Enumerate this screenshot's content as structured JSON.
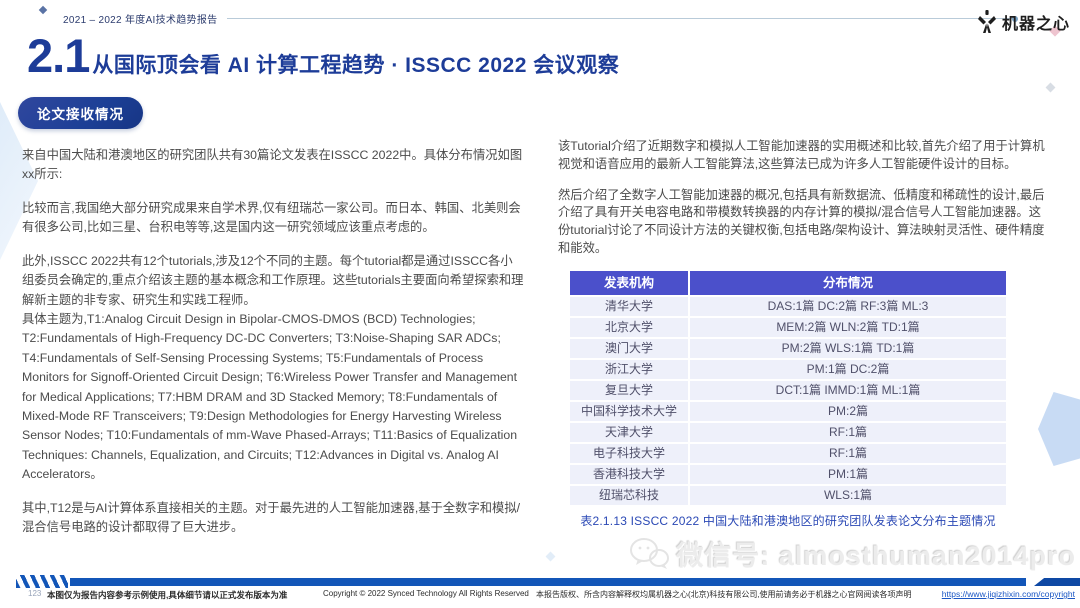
{
  "header": {
    "report_label": "2021 – 2022 年度AI技术趋势报告",
    "logo_text": "机器之心",
    "section_number": "2.1",
    "title": "从国际顶会看 AI 计算工程趋势 · ISSCC 2022 会议观察",
    "badge": "论文接收情况"
  },
  "left_column": {
    "paragraphs": [
      "来自中国大陆和港澳地区的研究团队共有30篇论文发表在ISSCC 2022中。具体分布情况如图xx所示:",
      "比较而言,我国绝大部分研究成果来自学术界,仅有纽瑞芯一家公司。而日本、韩国、北美则会有很多公司,比如三星、台积电等等,这是国内这一研究领域应该重点考虑的。",
      "此外,ISSCC 2022共有12个tutorials,涉及12个不同的主题。每个tutorial都是通过ISSCC各小组委员会确定的,重点介绍该主题的基本概念和工作原理。这些tutorials主要面向希望探索和理解新主题的非专家、研究生和实践工程师。",
      "具体主题为,T1:Analog Circuit Design in Bipolar-CMOS-DMOS (BCD) Technologies; T2:Fundamentals of High-Frequency DC-DC Converters; T3:Noise-Shaping SAR ADCs; T4:Fundamentals of Self-Sensing Processing Systems; T5:Fundamentals of Process Monitors for Signoff-Oriented Circuit Design; T6:Wireless Power Transfer and Management for Medical Applications; T7:HBM DRAM and 3D Stacked Memory; T8:Fundamentals of Mixed-Mode RF Transceivers; T9:Design Methodologies for Energy Harvesting Wireless Sensor Nodes; T10:Fundamentals of mm-Wave Phased-Arrays; T11:Basics of Equalization Techniques: Channels, Equalization, and Circuits; T12:Advances in Digital vs. Analog AI Accelerators。",
      "其中,T12是与AI计算体系直接相关的主题。对于最先进的人工智能加速器,基于全数字和模拟/混合信号电路的设计都取得了巨大进步。"
    ]
  },
  "right_column": {
    "paragraphs": [
      "该Tutorial介绍了近期数字和模拟人工智能加速器的实用概述和比较,首先介绍了用于计算机视觉和语音应用的最新人工智能算法,这些算法已成为许多人工智能硬件设计的目标。",
      "然后介绍了全数字人工智能加速器的概况,包括具有新数据流、低精度和稀疏性的设计,最后介绍了具有开关电容电路和带模数转换器的内存计算的模拟/混合信号人工智能加速器。这份tutorial讨论了不同设计方法的关键权衡,包括电路/架构设计、算法映射灵活性、硬件精度和能效。"
    ],
    "table": {
      "headers": [
        "发表机构",
        "分布情况"
      ],
      "rows": [
        [
          "清华大学",
          "DAS:1篇  DC:2篇  RF:3篇 ML:3"
        ],
        [
          "北京大学",
          "MEM:2篇 WLN:2篇 TD:1篇"
        ],
        [
          "澳门大学",
          "PM:2篇 WLS:1篇 TD:1篇"
        ],
        [
          "浙江大学",
          "PM:1篇 DC:2篇"
        ],
        [
          "复旦大学",
          "DCT:1篇 IMMD:1篇 ML:1篇"
        ],
        [
          "中国科学技术大学",
          "PM:2篇"
        ],
        [
          "天津大学",
          "RF:1篇"
        ],
        [
          "电子科技大学",
          "RF:1篇"
        ],
        [
          "香港科技大学",
          "PM:1篇"
        ],
        [
          "纽瑞芯科技",
          "WLS:1篇"
        ]
      ],
      "caption": "表2.1.13 ISSCC 2022 中国大陆和港澳地区的研究团队发表论文分布主题情况"
    }
  },
  "watermark": {
    "wechat_label": "微信号: almosthuman2014pro"
  },
  "footer": {
    "page_number": "123",
    "disclaimer": "本图仅为报告内容参考示例使用,具体细节请以正式发布版本为准",
    "copyright": "Copyright © 2022 Synced Technology  All Rights Reserved",
    "rights": "本报告版权、所含内容解释权均属机器之心(北京)科技有限公司,使用前请务必于机器之心官网阅读各项声明",
    "link": "https://www.jiqizhixin.com/copyright"
  },
  "colors": {
    "title_blue": "#1d3c98",
    "badge_blue": "#1c3f96",
    "table_header_bg": "#4b50cb",
    "table_row_bg": "#eef0fa",
    "caption_blue": "#2b49b5",
    "footer_bar_blue": "#1356b8",
    "link_blue": "#1a56c4"
  }
}
